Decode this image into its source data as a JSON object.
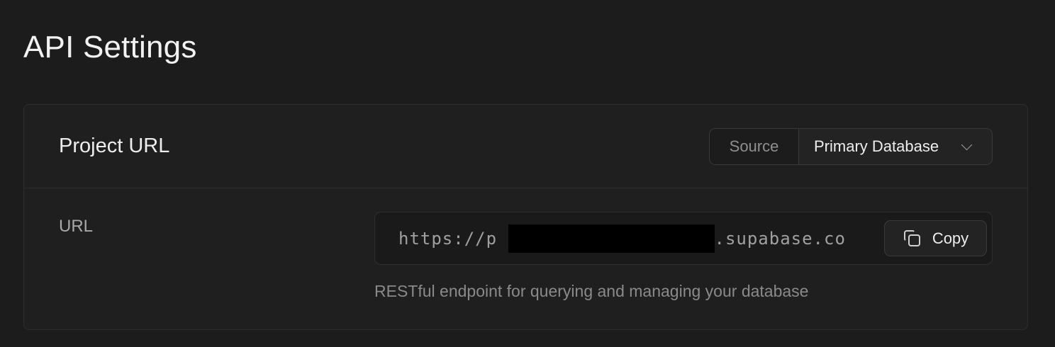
{
  "page": {
    "title": "API Settings"
  },
  "project_url": {
    "title": "Project URL",
    "source": {
      "label": "Source",
      "selected": "Primary Database"
    },
    "url": {
      "label": "URL",
      "prefix": "https://p",
      "suffix": "t.supabase.co",
      "copy_label": "Copy",
      "help_text": "RESTful endpoint for querying and managing your database"
    }
  },
  "colors": {
    "background": "#1c1c1c",
    "card": "#1f1f1f",
    "border": "#2e2e2e",
    "text": "#ededed",
    "muted": "#8a8a8a"
  }
}
